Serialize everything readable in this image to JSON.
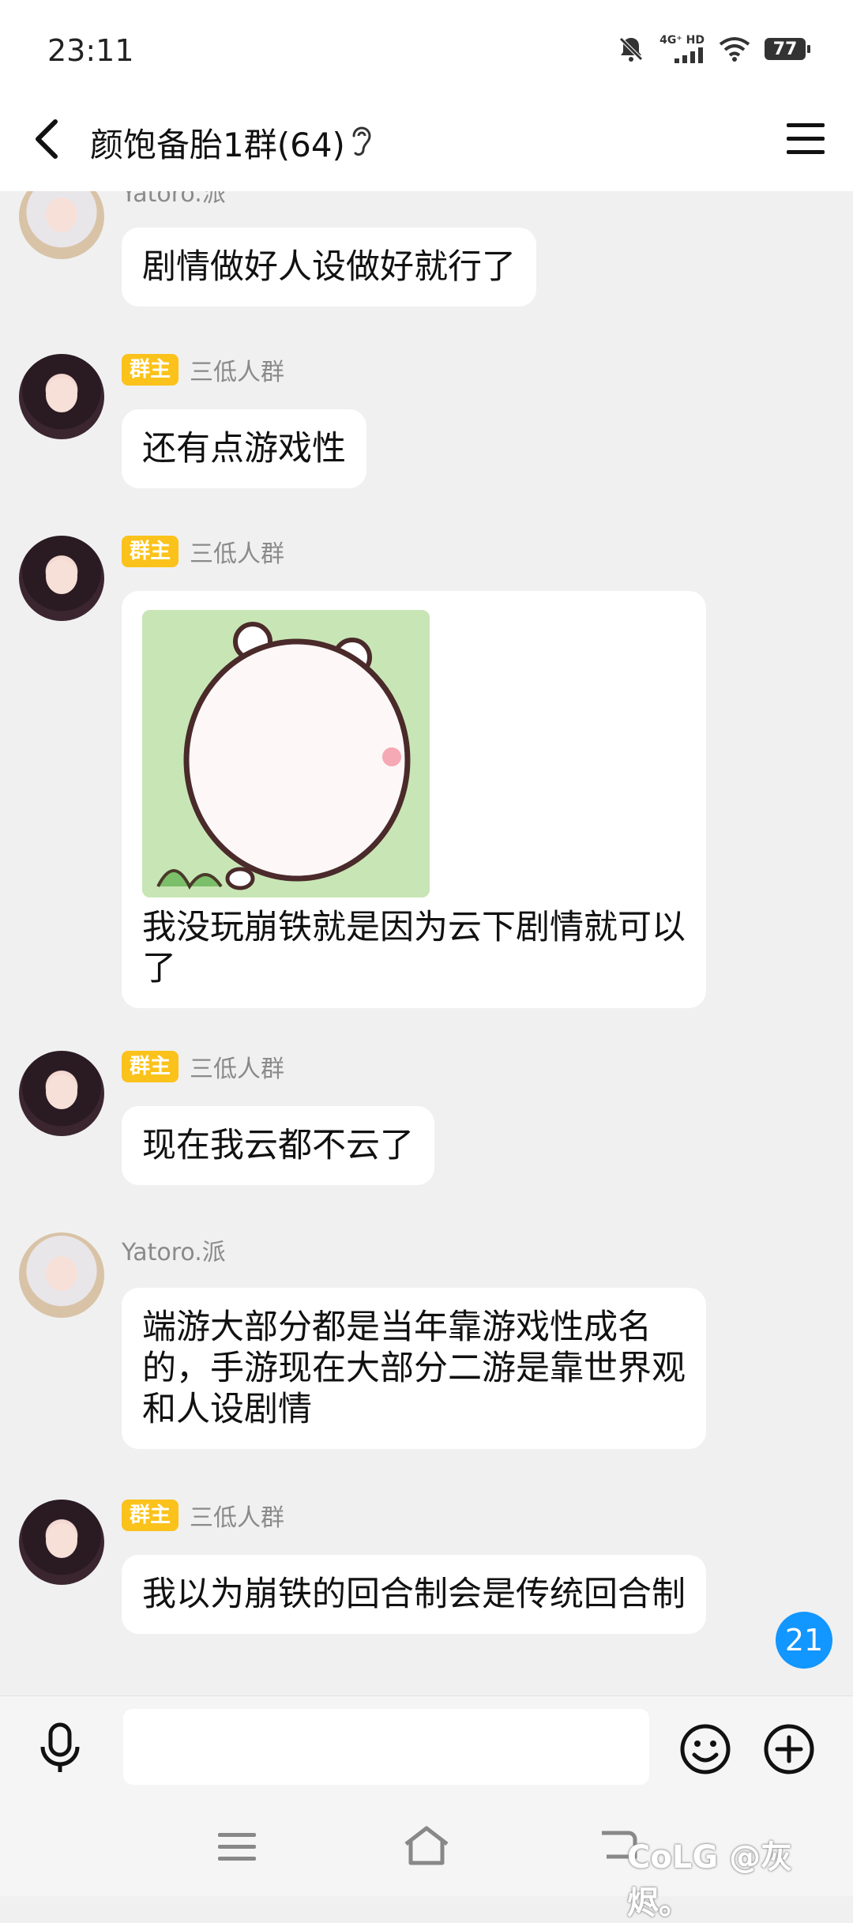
{
  "status_bar": {
    "time": "23:11",
    "network": "4G⁺ HD",
    "battery": "77"
  },
  "header": {
    "title": "颜饱备胎1群(64)"
  },
  "owner_badge": "群主",
  "messages": [
    {
      "sender": "Yatoro.派",
      "text": "剧情做好人设做好就行了"
    },
    {
      "sender": "三低人群",
      "text": "还有点游戏性"
    },
    {
      "sender": "三低人群",
      "text": "我没玩崩铁就是因为云下剧情就可以了"
    },
    {
      "sender": "三低人群",
      "text": "现在我云都不云了"
    },
    {
      "sender": "Yatoro.派",
      "text": "端游大部分都是当年靠游戏性成名的，手游现在大部分二游是靠世界观和人设剧情"
    },
    {
      "sender": "三低人群",
      "text": "我以为崩铁的回合制会是传统回合制"
    }
  ],
  "unread_count": "21",
  "watermark": "CoLG @灰烬。",
  "colors": {
    "badge": "#fbc21b",
    "unread": "#1296ff",
    "bubble": "#ffffff",
    "background": "#f0f0f0"
  }
}
